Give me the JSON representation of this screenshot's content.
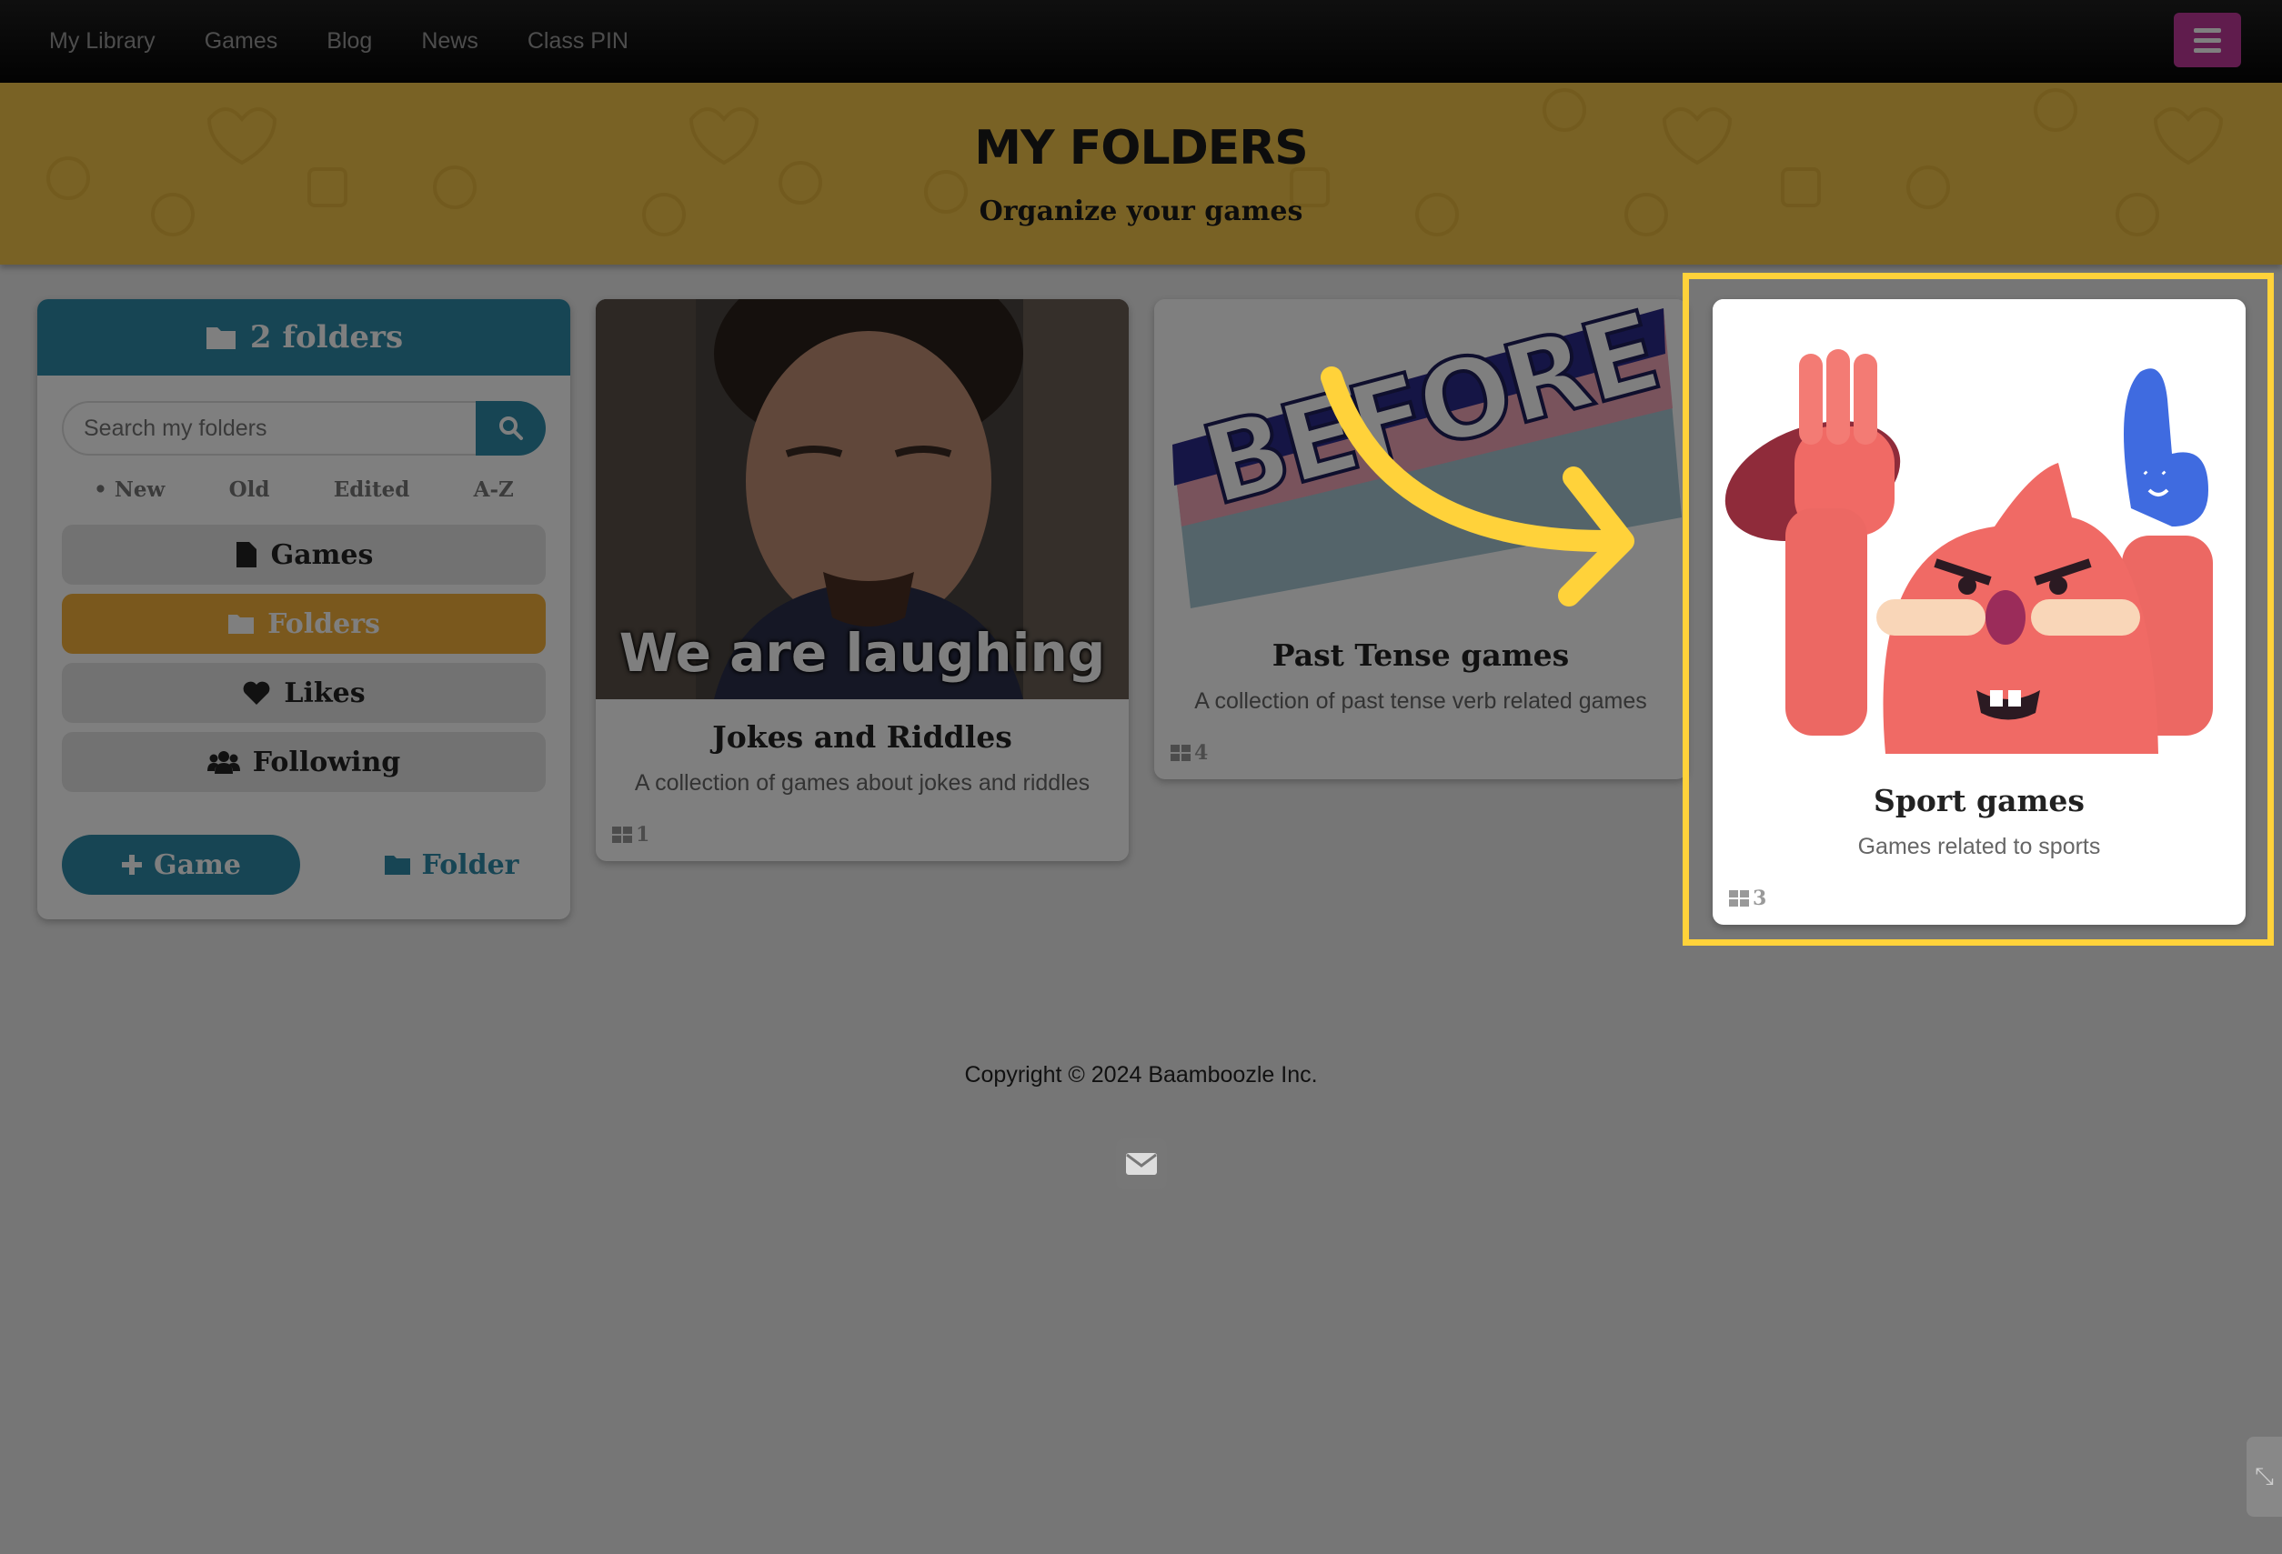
{
  "nav": {
    "links": [
      "My Library",
      "Games",
      "Blog",
      "News",
      "Class PIN"
    ],
    "menu_icon": "hamburger-icon",
    "menu_color": "#c0399b"
  },
  "hero": {
    "title": "MY FOLDERS",
    "subtitle": "Organize your games",
    "color": "#f2c54a"
  },
  "sidebar": {
    "header": "2 folders",
    "search_placeholder": "Search my folders",
    "sort_options": [
      "• New",
      "Old",
      "Edited",
      "A-Z"
    ],
    "items": [
      {
        "label": "Games",
        "icon": "file-icon",
        "active": false
      },
      {
        "label": "Folders",
        "icon": "folder-icon",
        "active": true
      },
      {
        "label": "Likes",
        "icon": "heart-icon",
        "active": false
      },
      {
        "label": "Following",
        "icon": "users-icon",
        "active": false
      }
    ],
    "add_game_label": "Game",
    "add_folder_label": "Folder",
    "accent": "#2f8aa8"
  },
  "cards": [
    {
      "title": "Jokes and Riddles",
      "description": "A collection of games about jokes and riddles",
      "count": "1",
      "image_caption": "We are laughing"
    },
    {
      "title": "Past Tense games",
      "description": "A collection of past tense verb related games",
      "count": "4",
      "image_caption": "BEFORE"
    },
    {
      "title": "Sport games",
      "description": "Games related to sports",
      "count": "3"
    }
  ],
  "footer": {
    "copyright": "Copyright © 2024 Baamboozle Inc.",
    "mail_icon": "envelope-icon"
  },
  "highlight_color": "#ffd23a"
}
